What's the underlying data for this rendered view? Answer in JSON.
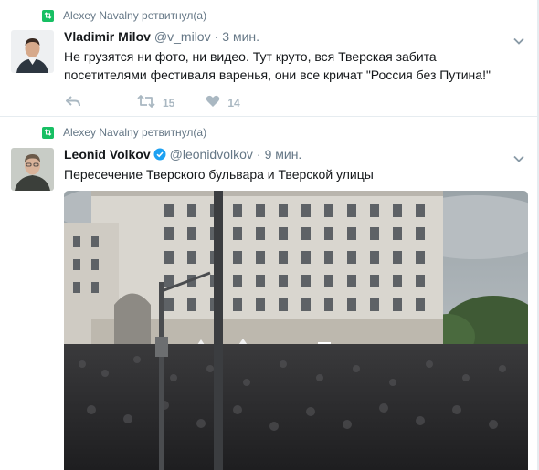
{
  "tweets": [
    {
      "retweeted_by": "Alexey Navalny ретвитнул(а)",
      "name": "Vladimir Milov",
      "handle": "@v_milov",
      "separator": "·",
      "time": "3 мин.",
      "text": "Не грузятся ни фото, ни видео. Тут круто, вся Тверская забита посетителями фестиваля варенья, они все кричат \"Россия без Путина!\"",
      "retweet_count": "15",
      "like_count": "14"
    },
    {
      "retweeted_by": "Alexey Navalny ретвитнул(а)",
      "name": "Leonid Volkov",
      "handle": "@leonidvolkov",
      "separator": "·",
      "time": "9 мин.",
      "text": "Пересечение Тверского бульвара и Тверской улицы",
      "verified": true
    }
  ],
  "icons": {
    "retweet": "retweet-icon",
    "reply": "reply-icon",
    "like": "heart-icon",
    "caret": "chevron-down-icon",
    "verified": "verified-badge-icon"
  },
  "colors": {
    "retweet_green": "#17bf63",
    "verified_blue": "#1da1f2",
    "muted": "#657786",
    "action_gray": "#aab8c2"
  }
}
